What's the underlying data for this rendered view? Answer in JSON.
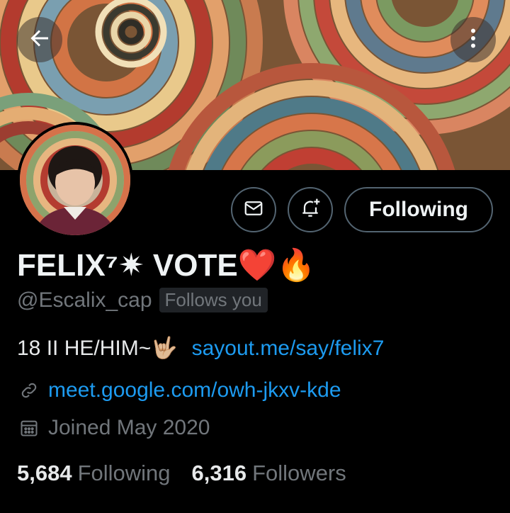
{
  "header": {
    "back_icon": "arrow-left-icon",
    "more_icon": "more-vertical-icon"
  },
  "profile": {
    "display_name": "FELIX⁷✷ VOTE❤️🔥",
    "handle": "@Escalix_cap",
    "follows_you": "Follows you",
    "bio_text": "18 II HE/HIM~🤟🏼",
    "bio_link": "sayout.me/say/felix7",
    "website": "meet.google.com/owh-jkxv-kde",
    "joined": "Joined May 2020"
  },
  "actions": {
    "message_icon": "envelope-icon",
    "notify_icon": "bell-plus-icon",
    "follow_label": "Following"
  },
  "stats": {
    "following_count": "5,684",
    "following_label": "Following",
    "followers_count": "6,316",
    "followers_label": "Followers"
  },
  "colors": {
    "link": "#1d9bf0",
    "muted": "#71767b",
    "background": "#000000"
  }
}
